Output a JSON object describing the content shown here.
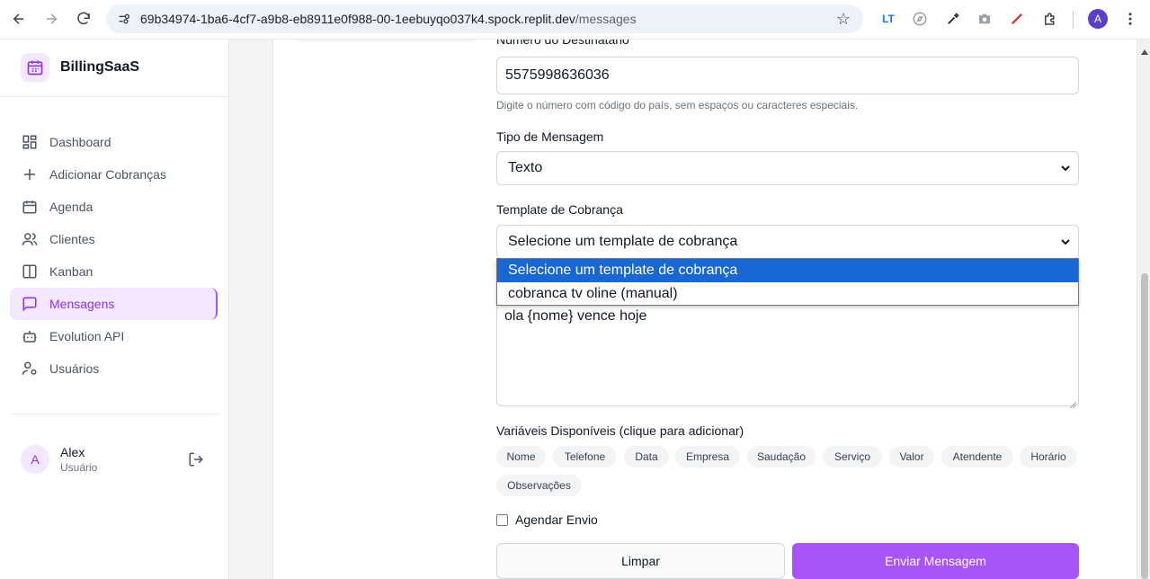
{
  "browser": {
    "url_host": "69b34974-1ba6-4cf7-a9b8-eb8911e0f988-00-1eebuyqo037k4.spock.replit.dev",
    "url_path": "/messages",
    "profile_initial": "A"
  },
  "sidebar": {
    "brand": "BillingSaaS",
    "items": [
      {
        "label": "Dashboard",
        "icon": "dashboard-icon"
      },
      {
        "label": "Adicionar Cobranças",
        "icon": "plus-icon"
      },
      {
        "label": "Agenda",
        "icon": "calendar-icon"
      },
      {
        "label": "Clientes",
        "icon": "users-icon"
      },
      {
        "label": "Kanban",
        "icon": "kanban-icon"
      },
      {
        "label": "Mensagens",
        "icon": "message-icon",
        "active": true
      },
      {
        "label": "Evolution API",
        "icon": "bot-icon"
      },
      {
        "label": "Usuários",
        "icon": "user-cog-icon"
      }
    ],
    "user": {
      "initial": "A",
      "name": "Alex",
      "role": "Usuário"
    }
  },
  "form": {
    "recipient_label": "Número do Destinatário",
    "recipient_value": "5575998636036",
    "recipient_hint": "Digite o número com código do país, sem espaços ou caracteres especiais.",
    "type_label": "Tipo de Mensagem",
    "type_value": "Texto",
    "template_label": "Template de Cobrança",
    "template_value": "Selecione um template de cobrança",
    "template_options": [
      "Selecione um template de cobrança",
      "cobranca tv oline (manual)"
    ],
    "message_value": "ola {nome} vence hoje",
    "variables_label": "Variáveis Disponíveis (clique para adicionar)",
    "variables": [
      "Nome",
      "Telefone",
      "Data",
      "Empresa",
      "Saudação",
      "Serviço",
      "Valor",
      "Atendente",
      "Horário",
      "Observações"
    ],
    "schedule_label": "Agendar Envio",
    "clear_button": "Limpar",
    "send_button": "Enviar Mensagem"
  },
  "colors": {
    "accent": "#a855f7",
    "accent_light": "#f3e8ff",
    "selected_option": "#1967d2"
  }
}
